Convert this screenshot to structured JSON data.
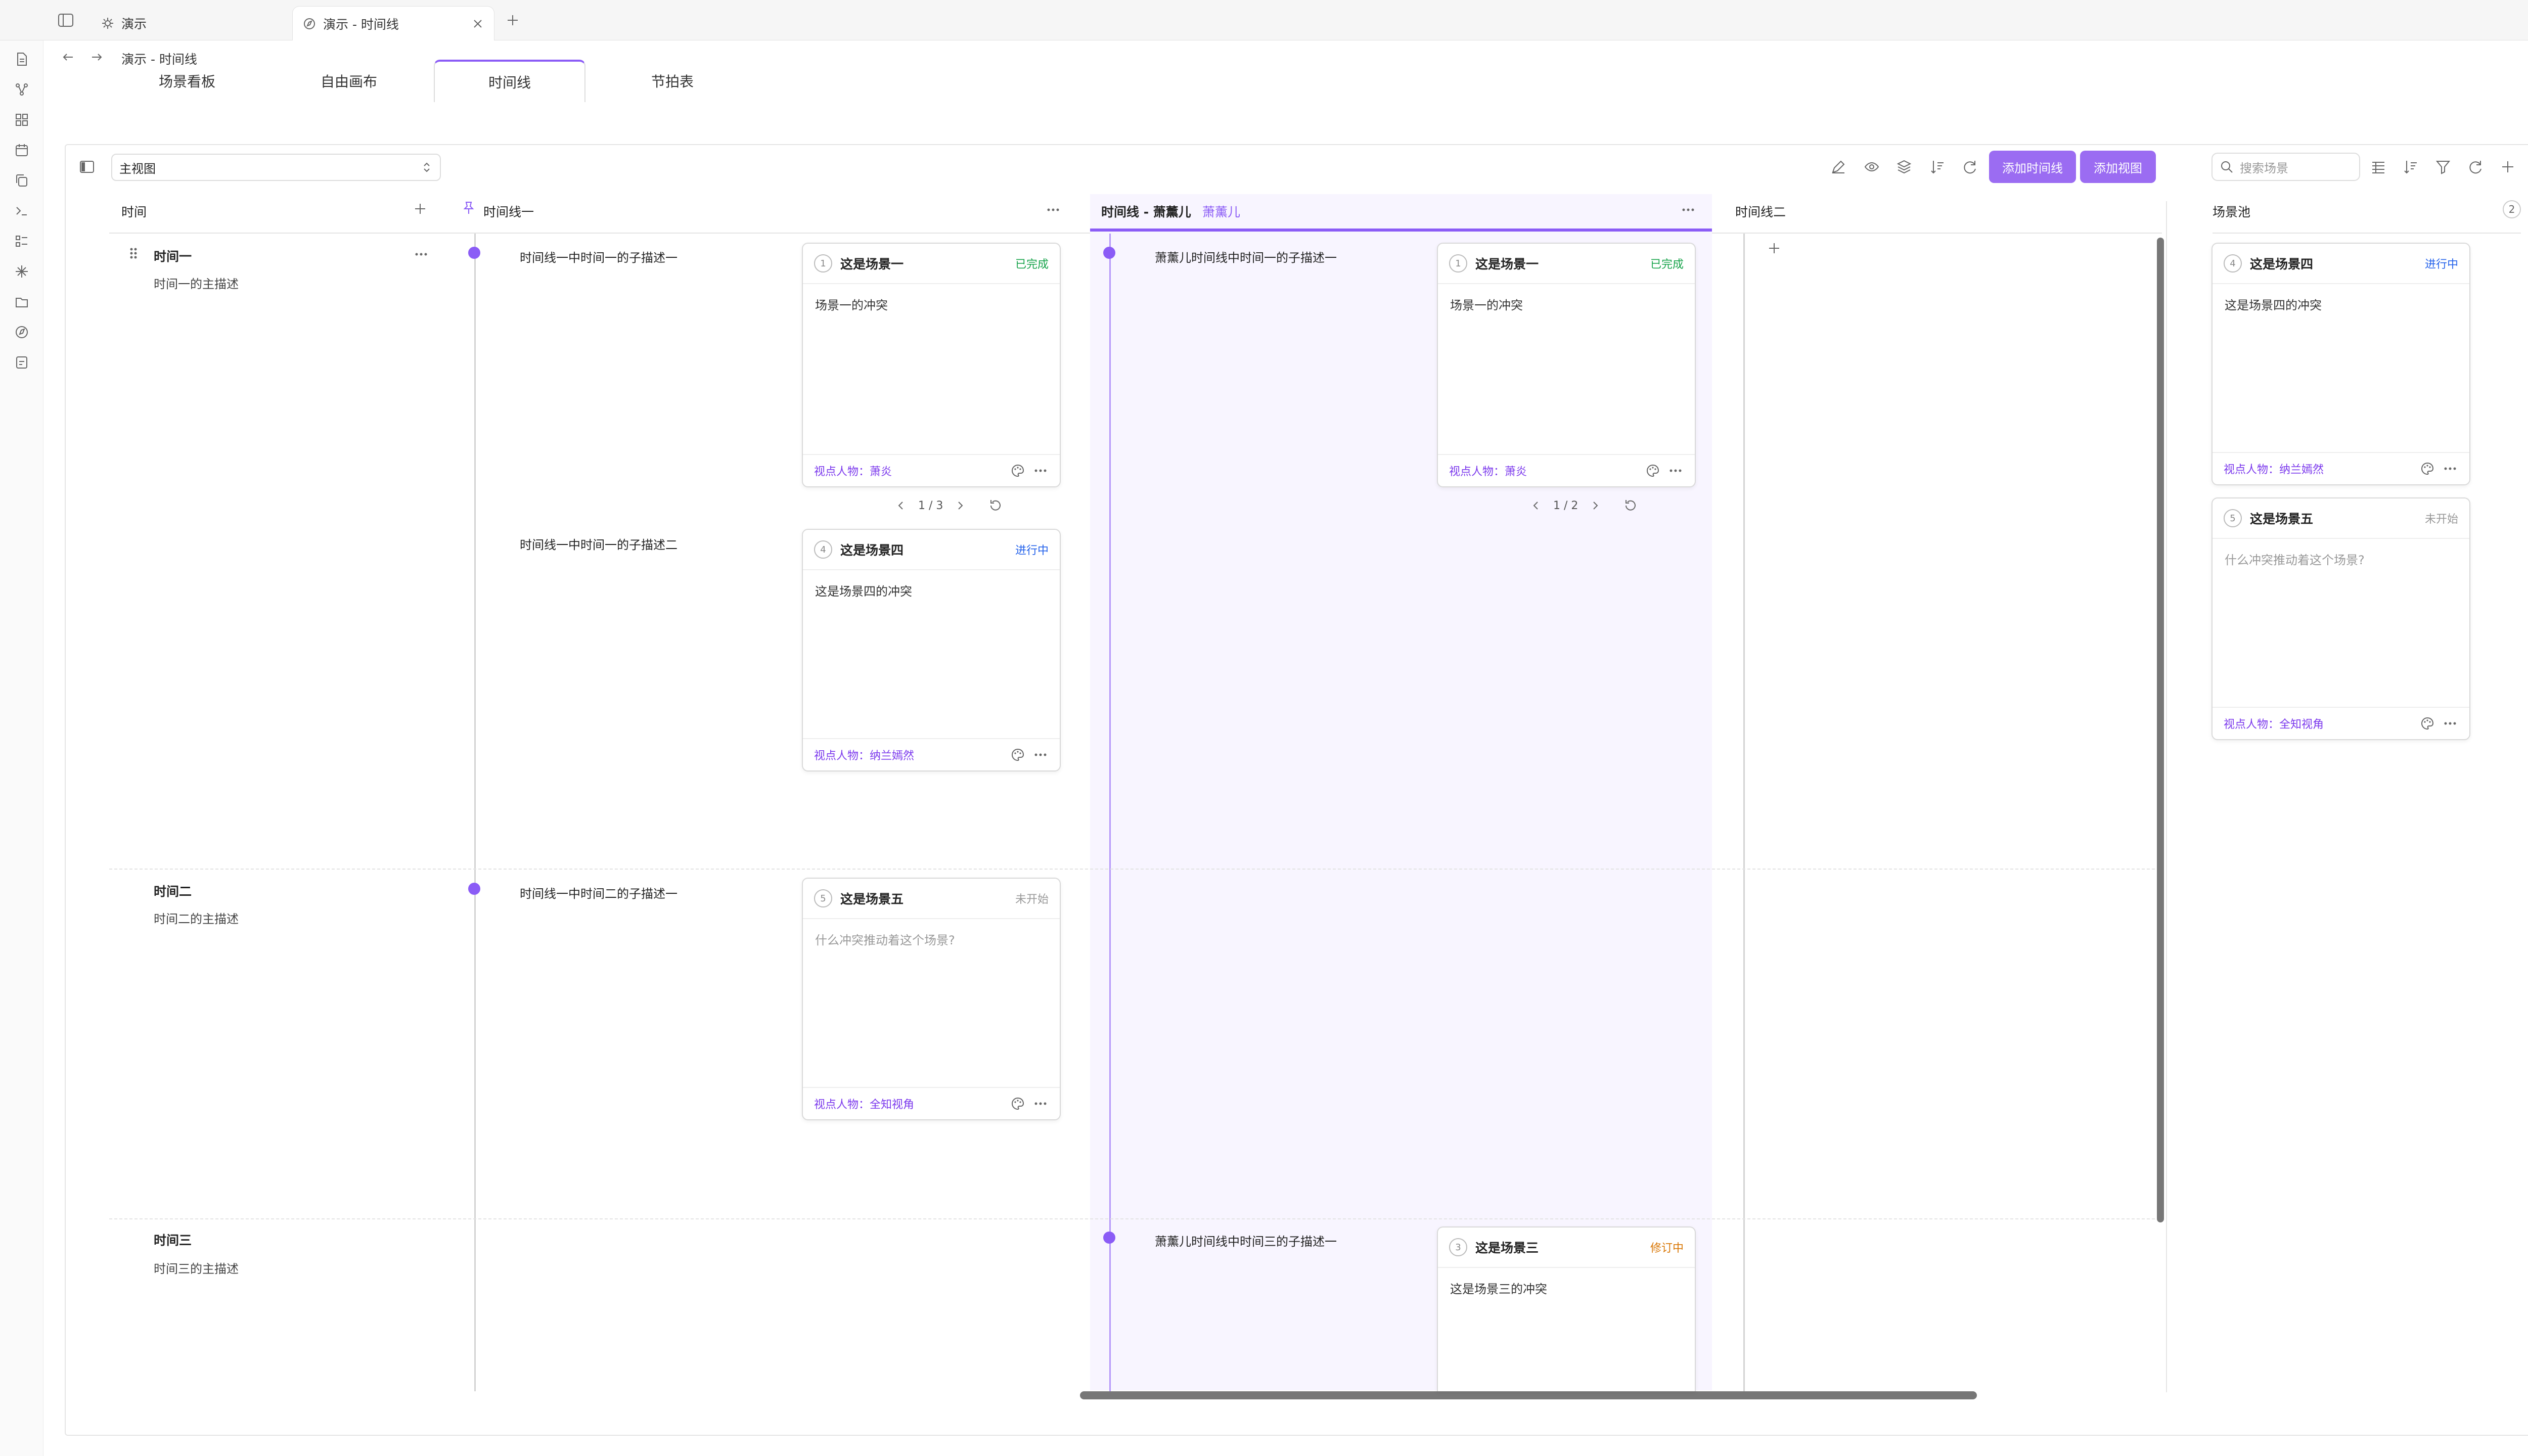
{
  "tabs": [
    {
      "label": "演示",
      "icon": "gear-icon"
    },
    {
      "label": "演示 - 时间线",
      "icon": "compass-icon"
    }
  ],
  "breadcrumb": "演示 - 时间线",
  "view_tabs": [
    "场景看板",
    "自由画布",
    "时间线",
    "节拍表"
  ],
  "active_view_tab": "时间线",
  "view_select": "主视图",
  "buttons": {
    "add_timeline": "添加时间线",
    "add_view": "添加视图"
  },
  "search": {
    "placeholder": "搜索场景"
  },
  "columns": {
    "time": "时间",
    "timeline1": "时间线一",
    "timeline2_title": "时间线 - 萧薰儿",
    "timeline2_tag": "萧薰儿",
    "timeline3": "时间线二"
  },
  "times": [
    {
      "title": "时间一",
      "desc": "时间一的主描述"
    },
    {
      "title": "时间二",
      "desc": "时间二的主描述"
    },
    {
      "title": "时间三",
      "desc": "时间三的主描述"
    }
  ],
  "subdescs": {
    "t1_a": "时间线一中时间一的子描述一",
    "t1_b": "时间线一中时间一的子描述二",
    "t1_c": "时间线一中时间二的子描述一",
    "t2_a": "萧薰儿时间线中时间一的子描述一",
    "t2_b": "萧薰儿时间线中时间三的子描述一"
  },
  "cards": {
    "c1": {
      "num": "1",
      "title": "这是场景一",
      "status": "已完成",
      "body": "场景一的冲突",
      "pov": "视点人物：萧炎"
    },
    "c2": {
      "num": "4",
      "title": "这是场景四",
      "status": "进行中",
      "body": "这是场景四的冲突",
      "pov": "视点人物：纳兰嫣然"
    },
    "c3": {
      "num": "5",
      "title": "这是场景五",
      "status": "未开始",
      "body": "什么冲突推动着这个场景?",
      "pov": "视点人物：全知视角"
    },
    "c4": {
      "num": "1",
      "title": "这是场景一",
      "status": "已完成",
      "body": "场景一的冲突",
      "pov": "视点人物：萧炎"
    },
    "c5": {
      "num": "3",
      "title": "这是场景三",
      "status": "修订中",
      "body": "这是场景三的冲突",
      "pov": ""
    }
  },
  "pagers": {
    "p1": "1 / 3",
    "p2": "1 / 2"
  },
  "pool": {
    "title": "场景池",
    "count": "2",
    "cards": [
      {
        "num": "4",
        "title": "这是场景四",
        "status": "进行中",
        "body": "这是场景四的冲突",
        "pov": "视点人物：纳兰嫣然"
      },
      {
        "num": "5",
        "title": "这是场景五",
        "status": "未开始",
        "body": "什么冲突推动着这个场景?",
        "pov": "视点人物：全知视角"
      }
    ]
  },
  "colors": {
    "accent": "#8b5cf6",
    "done": "#16a34a",
    "progress": "#2563eb",
    "todo": "#999999",
    "revise": "#d97706"
  }
}
